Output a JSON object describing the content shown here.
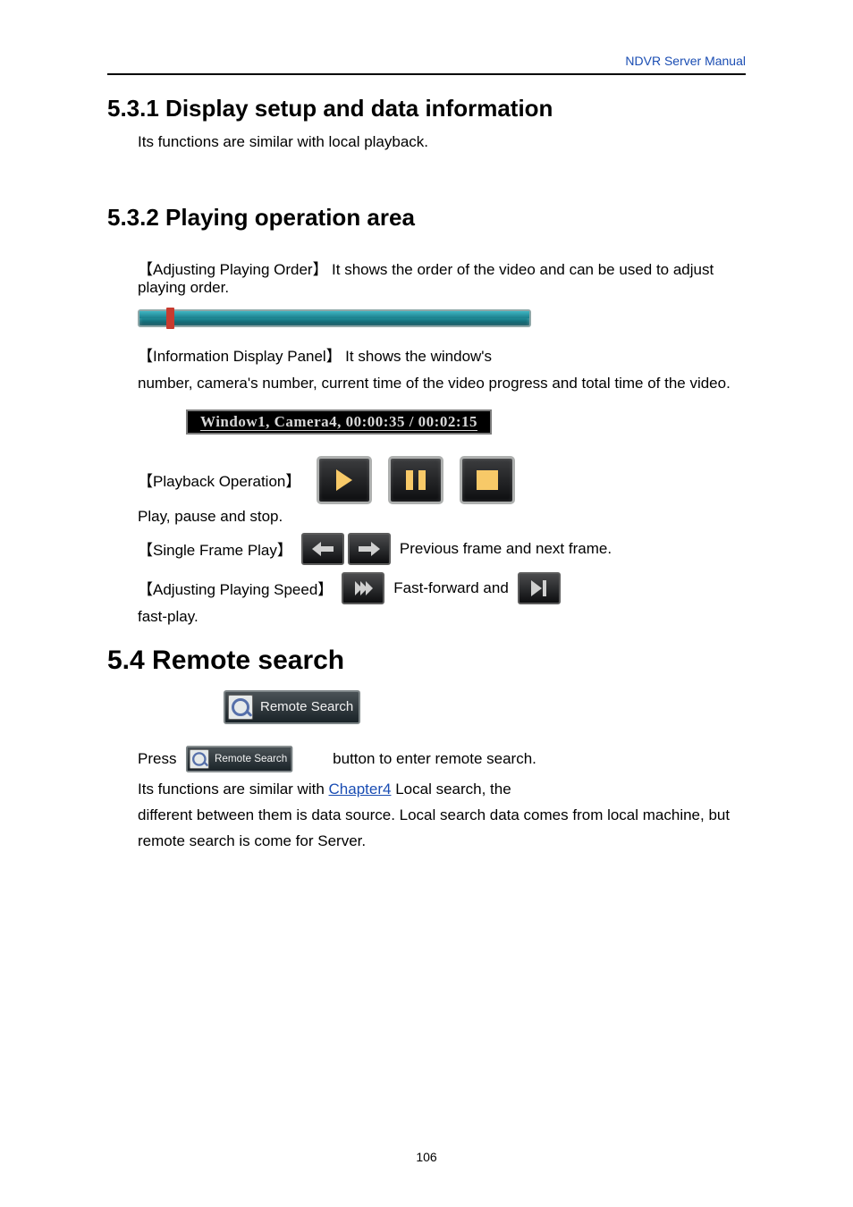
{
  "header": {
    "doc_title": "NDVR Server Manual"
  },
  "section_531": {
    "heading": "5.3.1 Display setup and data information",
    "body": "Its functions are similar with local playback."
  },
  "section_532": {
    "heading": "5.3.2 Playing operation area",
    "adjust_label_pre": "【Adjusting Playing Order】",
    "adjust_label_post": "It shows the order of the video and can be used to adjust playing order.",
    "info_text_pre": "【Information Display Panel】",
    "info_text_post": "It shows the window's",
    "info_text_line2": "number, camera's number, current time of the video progress and total time of the video.",
    "info_bar": "Window1,  Camera4,  00:00:35 / 00:02:15",
    "playback_pre": "【Playback Operation】",
    "playback_post": "Play, pause and stop.",
    "single_pre": "【Single Frame Play】",
    "single_post": "Previous frame and next frame.",
    "speed_pre": "【Adjusting Playing Speed】",
    "speed_mid": "Fast-forward and",
    "speed_end": "fast-play."
  },
  "section_54": {
    "heading": "5.4 Remote search",
    "remote_btn_label": "Remote Search",
    "para_pre": "Press",
    "para_mid1": "button to enter remote search.",
    "para_line2_pre": "Its functions are similar with",
    "para_link": "Chapter4",
    "para_line2_post": "Local search, the",
    "para_line3": "different between them is data source. Local search data comes from local machine, but remote search is come for Server."
  },
  "footer": {
    "page_number": "106"
  }
}
